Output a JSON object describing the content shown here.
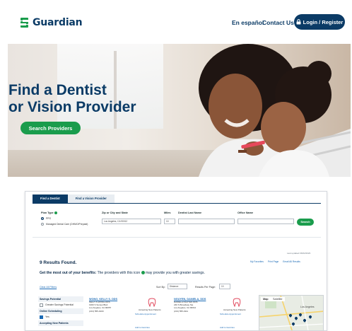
{
  "header": {
    "brand": "Guardian",
    "nav": {
      "espanol": "En español",
      "contact": "Contact Us"
    },
    "login_label": "Login / Register"
  },
  "hero": {
    "title_line1": "Find a Dentist",
    "title_line2": "or Vision Provider",
    "cta": "Search Providers"
  },
  "search": {
    "tabs": [
      "Find a Dentist",
      "Find a Vision Provider"
    ],
    "plan_type_label": "Plan Type",
    "plan_options": [
      "PPO",
      "Managed Dental Care (DHMO/Prepaid)"
    ],
    "zip_label": "Zip or City and State",
    "zip_value": "Los Angeles, CA 90012",
    "miles_label": "Miles",
    "miles_value": "10",
    "dentist_label": "Dentist Last Name",
    "office_label": "Office Name",
    "search_button": "Search"
  },
  "results": {
    "count_text": "9 Results Found.",
    "last_updated": "Last updated 06/02/2023",
    "links": [
      "My Favorites",
      "Print Page",
      "Email All Results"
    ],
    "promo_prefix": "Get the most out of your benefits:",
    "promo_rest": " The providers with this icon",
    "promo_suffix": " may provide you with greater savings.",
    "clear_filters": "Clear All Filters",
    "sort_label": "Sort By:",
    "sort_value": "Distance",
    "per_page_label": "Results Per Page:",
    "per_page_value": "10"
  },
  "filters": [
    {
      "heading": "Savings Potential",
      "option": "Greater Savings Potential",
      "checked": false
    },
    {
      "heading": "Online Scheduling",
      "option": "Yes",
      "checked": true
    },
    {
      "heading": "Accepting New Patients",
      "option": "",
      "checked": false
    }
  ],
  "providers": [
    {
      "name": "WONG, KELLY S. DDS",
      "practice": "KELLY S WONG DDS",
      "lines": [
        "1960 S Sunset Blvd",
        "Los Angeles, CA 90057",
        "(213) 555-0100"
      ],
      "status": "Accepting New Patients",
      "action": "Schedule Appointment",
      "favorite": "Add to favorites"
    },
    {
      "name": "NGUYEN, DANIELA, DDS",
      "practice": "DANIELA NGUYEN DDS",
      "lines": [
        "240 S Broadway Ste",
        "Los Angeles, CA 90012",
        "(213) 555-0111"
      ],
      "status": "Accepting New Patients",
      "action": "Schedule Appointment",
      "favorite": "Add to favorites"
    }
  ],
  "map": {
    "tabs": [
      "Map",
      "Satellite"
    ],
    "place": "Los Angeles"
  },
  "colors": {
    "brand": "#0b3b66",
    "cta": "#1a9c4c",
    "link": "#1c6bb6"
  }
}
